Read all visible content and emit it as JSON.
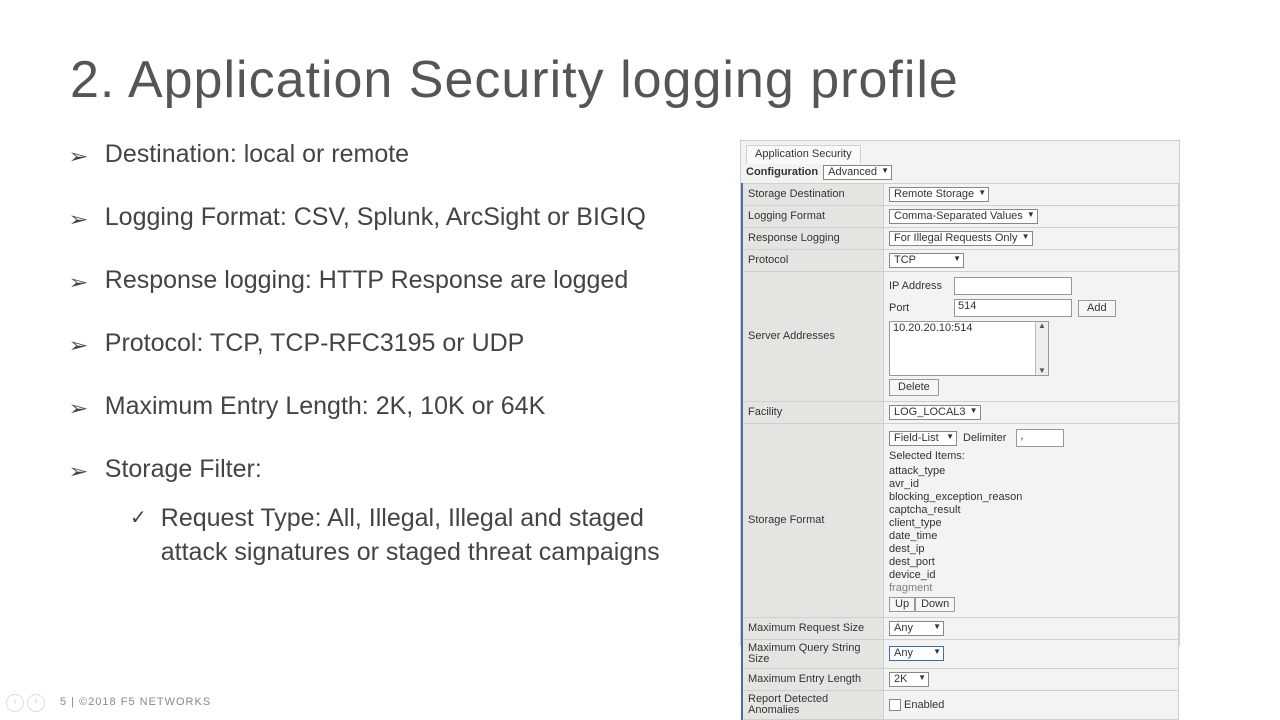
{
  "title": "2. Application Security logging profile",
  "bullets": [
    "Destination: local or remote",
    "Logging Format: CSV, Splunk, ArcSight or BIGIQ",
    "Response logging: HTTP Response are logged",
    "Protocol: TCP, TCP-RFC3195 or UDP",
    "Maximum Entry Length: 2K, 10K or 64K",
    "Storage Filter:"
  ],
  "sub_bullet": "Request Type: All, Illegal, Illegal and staged attack signatures or staged threat campaigns",
  "panel": {
    "tab_label": "Application Security",
    "configuration_label": "Configuration",
    "configuration_value": "Advanced",
    "rows": {
      "storage_destination": {
        "label": "Storage Destination",
        "value": "Remote Storage"
      },
      "logging_format": {
        "label": "Logging Format",
        "value": "Comma-Separated Values"
      },
      "response_logging": {
        "label": "Response Logging",
        "value": "For Illegal Requests Only"
      },
      "protocol": {
        "label": "Protocol",
        "value": "TCP"
      },
      "server_addresses": {
        "label": "Server Addresses",
        "ip_label": "IP Address",
        "ip_value": "",
        "port_label": "Port",
        "port_value": "514",
        "add_button": "Add",
        "list_entry": "10.20.20.10:514",
        "delete_button": "Delete"
      },
      "facility": {
        "label": "Facility",
        "value": "LOG_LOCAL3"
      },
      "storage_format": {
        "label": "Storage Format",
        "mode_value": "Field-List",
        "delimiter_label": "Delimiter",
        "delimiter_value": ",",
        "selected_items_label": "Selected Items:",
        "selected_items": [
          "attack_type",
          "avr_id",
          "blocking_exception_reason",
          "captcha_result",
          "client_type",
          "date_time",
          "dest_ip",
          "dest_port",
          "device_id",
          "fragment"
        ],
        "up_button": "Up",
        "down_button": "Down"
      },
      "maximum_request_size": {
        "label": "Maximum Request Size",
        "value": "Any"
      },
      "maximum_query_string_size": {
        "label": "Maximum Query String Size",
        "value": "Any"
      },
      "maximum_entry_length": {
        "label": "Maximum Entry Length",
        "value": "2K"
      },
      "report_detected_anomalies": {
        "label": "Report Detected Anomalies",
        "checkbox_label": "Enabled",
        "checked": false
      }
    }
  },
  "footer": "5 | ©2018 F5 NETWORKS"
}
